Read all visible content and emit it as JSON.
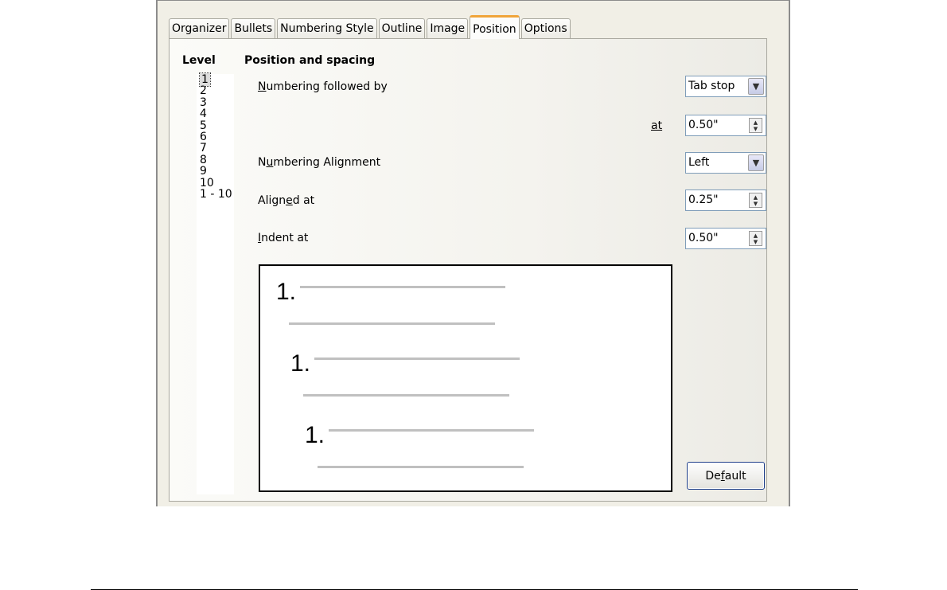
{
  "tabs": [
    "Organizer",
    "Bullets",
    "Numbering Style",
    "Outline",
    "Image",
    "Position",
    "Options"
  ],
  "active_tab": "Position",
  "level_heading": "Level",
  "levels": [
    "1",
    "2",
    "3",
    "4",
    "5",
    "6",
    "7",
    "8",
    "9",
    "10",
    "1 - 10"
  ],
  "selected_level": "1",
  "section_heading": "Position and spacing",
  "numbering_followed_by": {
    "label": "Numbering followed by",
    "value": "Tab stop"
  },
  "tab_at": {
    "label": "at",
    "value": "0.50\""
  },
  "numbering_alignment": {
    "label": "Numbering Alignment",
    "value": "Left"
  },
  "aligned_at": {
    "label": "Aligned at",
    "value": "0.25\""
  },
  "indent_at": {
    "label": "Indent at",
    "value": "0.50\""
  },
  "preview": {
    "numbers": [
      "1.",
      "1.",
      "1."
    ]
  },
  "default_button": "Default",
  "icons": {
    "dropdown": "chevron-down-icon",
    "spin": "spin-arrows-icon"
  }
}
